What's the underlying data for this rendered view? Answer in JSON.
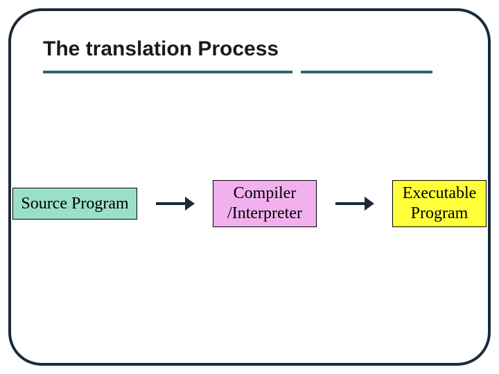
{
  "title": "The translation Process",
  "boxes": {
    "source": "Source Program",
    "compiler_line1": "Compiler",
    "compiler_line2": "/Interpreter",
    "exec_line1": "Executable",
    "exec_line2": "Program"
  },
  "colors": {
    "border": "#1a2a3a",
    "underline": "#336666",
    "source_bg": "#9be0c6",
    "compiler_bg": "#f3b0ee",
    "exec_bg": "#ffff3a"
  }
}
